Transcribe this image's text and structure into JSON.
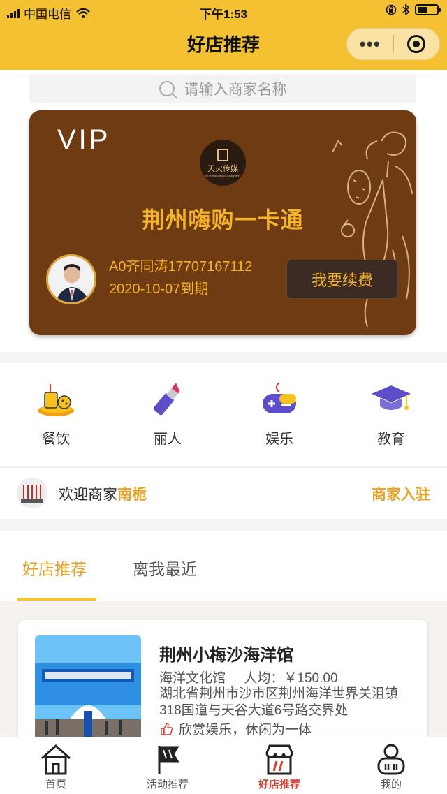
{
  "status_bar": {
    "carrier": "中国电信",
    "time": "下午1:53"
  },
  "nav": {
    "title": "好店推荐",
    "more_icon": "more-dots-icon",
    "target_icon": "target-icon"
  },
  "search": {
    "placeholder": "请输入商家名称"
  },
  "card": {
    "vip": "VIP",
    "logo_text": "天火传媒",
    "logo_sub": "SKYFIRE MEDIA COMPANY",
    "name": "荆州嗨购一卡通",
    "user_line": "A0齐同涛17707167112",
    "expiry": "2020-10-07到期",
    "renew_label": "我要续费"
  },
  "categories": [
    {
      "label": "餐饮",
      "icon": "food-icon"
    },
    {
      "label": "丽人",
      "icon": "lipstick-icon"
    },
    {
      "label": "娱乐",
      "icon": "gamepad-icon"
    },
    {
      "label": "教育",
      "icon": "graduation-cap-icon"
    }
  ],
  "welcome": {
    "prefix": "欢迎商家",
    "merchant": "南栀",
    "join_label": "商家入驻"
  },
  "tabs": [
    {
      "label": "好店推荐",
      "active": true
    },
    {
      "label": "离我最近",
      "active": false
    }
  ],
  "shops": [
    {
      "name": "荆州小梅沙海洋馆",
      "category": "海洋文化馆",
      "avg_price": "人均：￥150.00",
      "address": "湖北省荆州市沙市区荆州海洋世界关沮镇318国道与天谷大道6号路交界处",
      "tag": "欣赏娱乐，休闲为一体"
    }
  ],
  "tabbar": [
    {
      "label": "首页",
      "icon": "home-icon",
      "active": false
    },
    {
      "label": "活动推荐",
      "icon": "flag-icon",
      "active": false
    },
    {
      "label": "好店推荐",
      "icon": "shop-icon",
      "active": true
    },
    {
      "label": "我的",
      "icon": "user-icon",
      "active": false
    }
  ],
  "colors": {
    "header": "#f4c132",
    "card": "#6f3b12",
    "accent": "#e8a326",
    "active_tab": "#d14034"
  }
}
